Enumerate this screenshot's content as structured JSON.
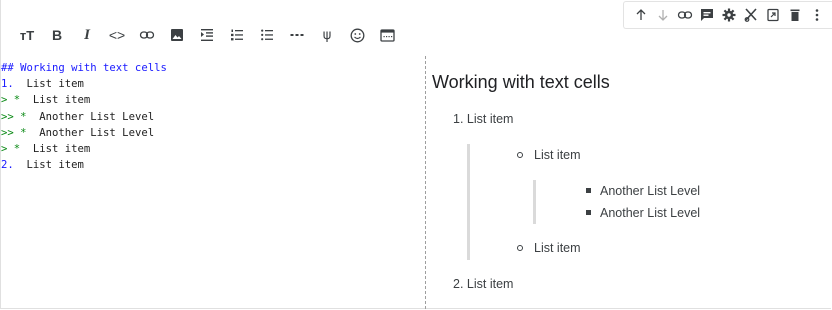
{
  "cell_toolbar": {
    "buttons": [
      {
        "icon": "arrow-up-icon",
        "name": "move-cell-up-button"
      },
      {
        "icon": "arrow-down-icon",
        "name": "move-cell-down-button"
      },
      {
        "icon": "link-icon",
        "name": "copy-cell-link-button"
      },
      {
        "icon": "comment-icon",
        "name": "add-comment-button"
      },
      {
        "icon": "gear-icon",
        "name": "editor-settings-button"
      },
      {
        "icon": "scissors-icon",
        "name": "close-editor-button"
      },
      {
        "icon": "mirror-tab-icon",
        "name": "mirror-cell-button"
      },
      {
        "icon": "trash-icon",
        "name": "delete-cell-button"
      },
      {
        "icon": "more-vert-icon",
        "name": "more-actions-button"
      }
    ]
  },
  "format_toolbar": {
    "buttons": [
      {
        "icon": "text-size-icon",
        "label": "тT"
      },
      {
        "icon": "bold-icon",
        "label": "B"
      },
      {
        "icon": "italic-icon",
        "label": "I"
      },
      {
        "icon": "code-icon",
        "label": "<>"
      },
      {
        "icon": "link-icon",
        "label": ""
      },
      {
        "icon": "image-icon",
        "label": ""
      },
      {
        "icon": "indent-icon",
        "label": ""
      },
      {
        "icon": "numbered-list-icon",
        "label": ""
      },
      {
        "icon": "bulleted-list-icon",
        "label": ""
      },
      {
        "icon": "horizontal-rule-icon",
        "label": ""
      },
      {
        "icon": "psi-icon",
        "label": "ψ"
      },
      {
        "icon": "emoji-icon",
        "label": ""
      },
      {
        "icon": "preview-panel-icon",
        "label": ""
      }
    ]
  },
  "editor": {
    "lines": [
      {
        "prefix": "## Working with text cells",
        "text": "",
        "style": "blue"
      },
      {
        "prefix": "1.",
        "text": "  List item",
        "style": "blue"
      },
      {
        "prefix": "> *",
        "text": "  List item",
        "style": "green"
      },
      {
        "prefix": ">> *",
        "text": "  Another List Level",
        "style": "green"
      },
      {
        "prefix": ">> *",
        "text": "  Another List Level",
        "style": "green"
      },
      {
        "prefix": "> *",
        "text": "  List item",
        "style": "green"
      },
      {
        "prefix": "2.",
        "text": "  List item",
        "style": "blue"
      }
    ]
  },
  "preview": {
    "heading": "Working with text cells",
    "item1": "1. List item",
    "sub1": "List item",
    "deep1": "Another List Level",
    "deep2": "Another List Level",
    "sub2": "List item",
    "item2": "2. List item"
  },
  "colors": {
    "markdown_blue": "#1a1aff",
    "quote_green": "#0b8a16",
    "text": "#3c4043"
  }
}
